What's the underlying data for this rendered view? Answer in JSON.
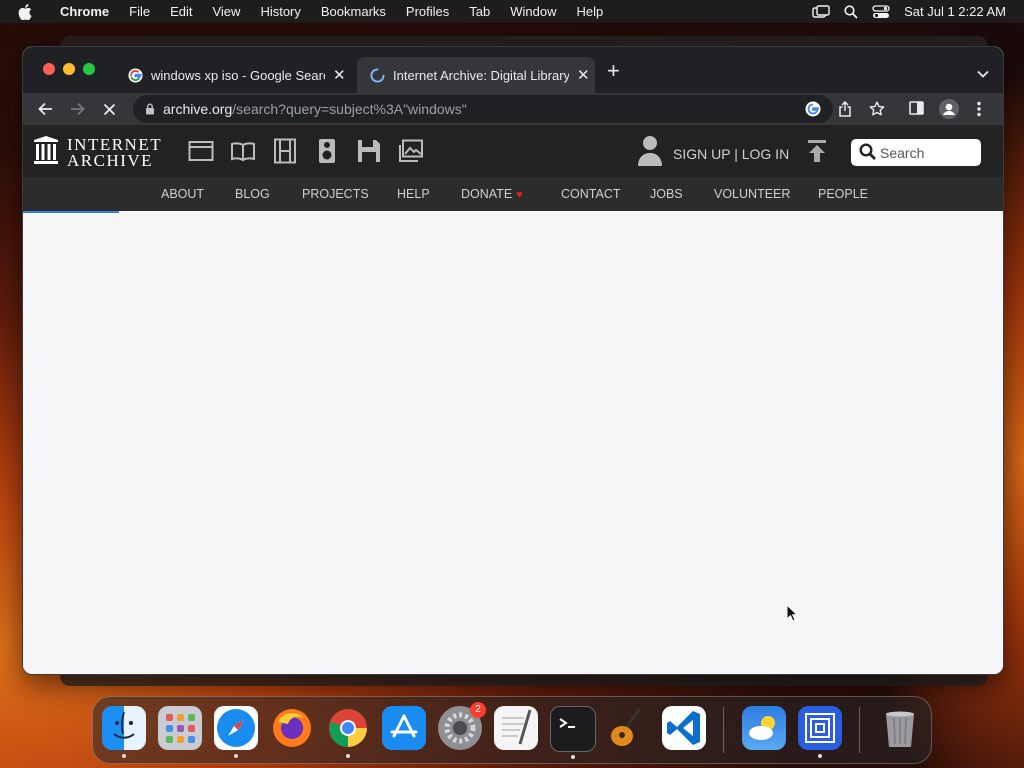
{
  "menubar": {
    "app": "Chrome",
    "items": [
      "File",
      "Edit",
      "View",
      "History",
      "Bookmarks",
      "Profiles",
      "Tab",
      "Window",
      "Help"
    ],
    "clock": "Sat Jul 1  2:22 AM"
  },
  "browser": {
    "tabs": [
      {
        "title": "windows xp iso - Google Search",
        "favicon": "google-icon",
        "active": false
      },
      {
        "title": "Internet Archive: Digital Library",
        "favicon": "loading-spinner-icon",
        "active": true
      }
    ],
    "url_host": "archive.org",
    "url_path": "/search?query=subject%3A\"windows\""
  },
  "ia": {
    "logo_line1": "INTERNET",
    "logo_line2": "ARCHIVE",
    "media": [
      "web-icon",
      "texts-icon",
      "video-icon",
      "audio-icon",
      "software-icon",
      "images-icon"
    ],
    "signup": "SIGN UP | LOG IN",
    "search_placeholder": "Search",
    "nav": [
      "ABOUT",
      "BLOG",
      "PROJECTS",
      "HELP",
      "DONATE",
      "CONTACT",
      "JOBS",
      "VOLUNTEER",
      "PEOPLE"
    ],
    "heart": "♥"
  },
  "dock": {
    "apps": [
      "Finder",
      "Launchpad",
      "Safari",
      "Firefox",
      "Chrome",
      "App Store",
      "System Settings",
      "TextEdit",
      "Terminal",
      "GarageBand",
      "Visual Studio Code",
      "Weather",
      "Screen Sharing",
      "Trash"
    ],
    "settings_badge": "2"
  },
  "colors": {
    "accent_progress": "#3b7de0",
    "ia_bar": "#222222",
    "donate_heart": "#e02020"
  }
}
